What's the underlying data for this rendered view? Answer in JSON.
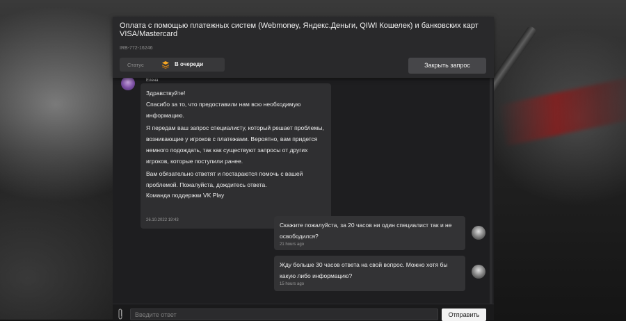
{
  "ticket": {
    "title": "Оплата с помощью платежных систем (Webmoney, Яндекс.Деньги, QIWI Кошелек) и банковских карт VISA/Mastercard",
    "id": "IRB-772-16246",
    "status_label": "Статус",
    "status_value": "В очереди",
    "status_icon": "layers-icon",
    "close_label": "Закрыть запрос"
  },
  "agent_message": {
    "author": "Елена",
    "lines": [
      "Здравствуйте!",
      "Спасибо за то, что предоставили нам всю необходимую информацию.",
      "Я передам ваш запрос специалисту, который решает проблемы, возникающие у игроков с платежами. Вероятно, вам придется немного подождать, так как существуют запросы от других игроков, которые поступили ранее.",
      "Вам обязательно ответят и постараются помочь с вашей проблемой. Пожалуйста, дождитесь ответа.",
      "Команда поддержки VK Play"
    ],
    "time": "26.10.2022 19:43",
    "like_icon": "thumbs-up-icon",
    "dislike_icon": "thumbs-down-icon"
  },
  "user_messages": [
    {
      "text": "Скажите пожалуйста, за 20 часов ни один специалист так и не освободился?",
      "time": "21 hours ago"
    },
    {
      "text": "Жду больше 30 часов ответа на свой вопрос. Можно хотя бы какую либо информацию?",
      "time": "15 hours ago"
    }
  ],
  "composer": {
    "placeholder": "Введите ответ",
    "send_label": "Отправить",
    "attach_icon": "paperclip-icon"
  },
  "colors": {
    "accent_status": "#f5a623",
    "panel": "#1e1e20",
    "bubble": "#2f2f31"
  }
}
